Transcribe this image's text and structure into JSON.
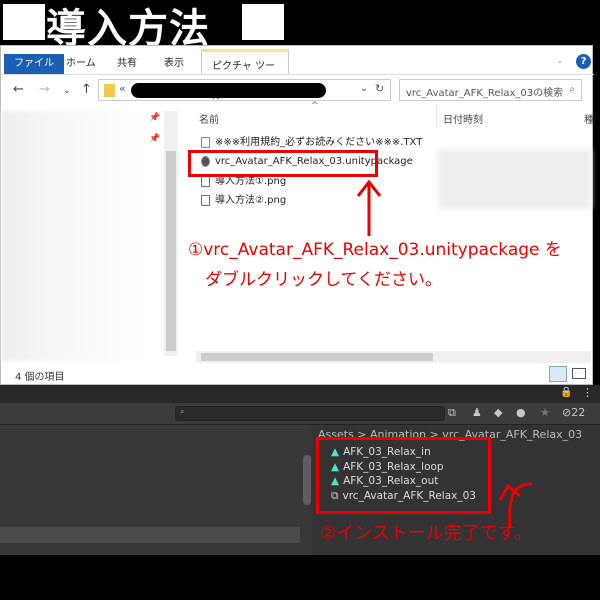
{
  "title": "導入方法",
  "explorer": {
    "tabs": [
      "ファイル",
      "ホーム",
      "共有",
      "表示",
      "ピクチャ ツール"
    ],
    "address_prefix": "«",
    "search_placeholder": "vrc_Avatar_AFK_Relax_03の検索",
    "columns": [
      "名前",
      "日付時刻",
      "種"
    ],
    "files": [
      {
        "name": "※※※利用規約_必ずお読みください※※※.TXT",
        "icon": "text-file-icon"
      },
      {
        "name": "vrc_Avatar_AFK_Relax_03.unitypackage",
        "icon": "unity-package-icon"
      },
      {
        "name": "導入方法①.png",
        "icon": "image-file-icon"
      },
      {
        "name": "導入方法②.png",
        "icon": "image-file-icon"
      }
    ],
    "status": "4 個の項目"
  },
  "annotation1": [
    "①vrc_Avatar_AFK_Relax_03.unitypackage を",
    "ダブルクリックしてください。"
  ],
  "unity": {
    "hidden_count": "22",
    "breadcrumb": "Assets > Animation > vrc_Avatar_AFK_Relax_03",
    "assets": [
      "AFK_03_Relax_in",
      "AFK_03_Relax_loop",
      "AFK_03_Relax_out",
      "vrc_Avatar_AFK_Relax_03"
    ]
  },
  "annotation2": "②インストール完了です。"
}
